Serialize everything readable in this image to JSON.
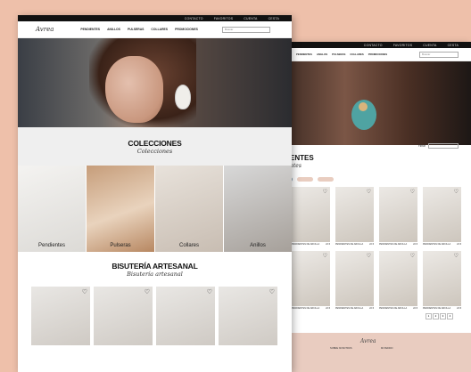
{
  "topbar": {
    "front_links": [
      "CONTACTO",
      "FAVORITOS",
      "CUENTA",
      "CESTA"
    ],
    "back_links": [
      "CONTACTO",
      "FAVORITOS",
      "CUENTA",
      "CESTA"
    ]
  },
  "nav": {
    "logo": "Avrea",
    "links": [
      "PENDIENTES",
      "ANILLOS",
      "PULSERAS",
      "COLLARES",
      "PROMOCIONES"
    ],
    "search_placeholder": "Buscar"
  },
  "colecciones": {
    "title": "COLECCIONES",
    "script": "Colecciones",
    "categories": [
      "Pendientes",
      "Pulseras",
      "Collares",
      "Anillos"
    ]
  },
  "artesanal": {
    "title": "BISUTERÍA ARTESANAL",
    "script": "Bisutería artesanal"
  },
  "back": {
    "title": "ENTES",
    "script": "ntes",
    "filter_label": "Filtrar",
    "product_names": [
      "PENDIENTES DE ARCILLA",
      "PENDIENTES DE ARCILLA",
      "PENDIENTES DE ARCILLA",
      "PENDIENTES DE ARCILLA",
      "PENDIENTES DE ARCILLA",
      "PENDIENTES DE ARCILLA",
      "PENDIENTES DE ARCILLA",
      "PENDIENTES DE ARCILLA"
    ],
    "product_price": "22 €",
    "pages": [
      "1",
      "2",
      "3",
      "4"
    ],
    "footer_logo": "Avrea",
    "footer_col1": "SOBRE NOSOTROS",
    "footer_col2": "MI PEDIDO"
  },
  "colors": {
    "background": "#eec0aa",
    "topbar": "#111111",
    "footer": "#e9ccc0"
  }
}
